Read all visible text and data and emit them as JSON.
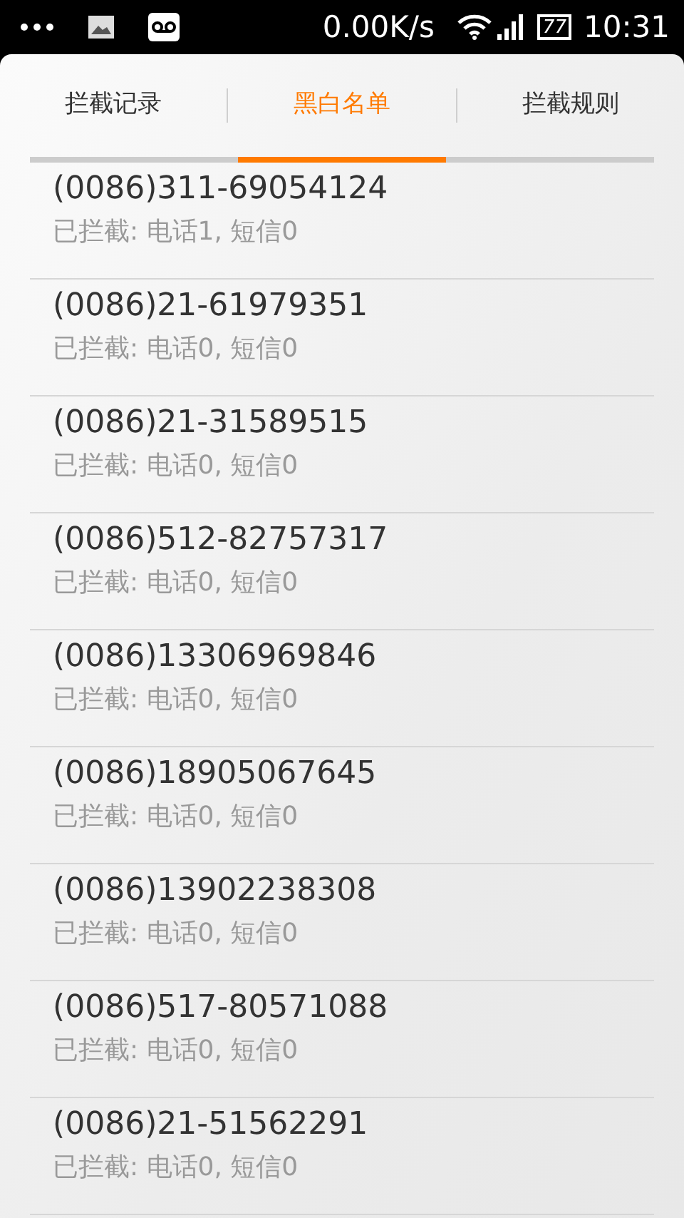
{
  "status_bar": {
    "speed": "0.00K/s",
    "battery": "77",
    "time": "10:31"
  },
  "tabs": [
    {
      "label": "拦截记录",
      "selected": false
    },
    {
      "label": "黑白名单",
      "selected": true
    },
    {
      "label": "拦截规则",
      "selected": false
    }
  ],
  "entries": [
    {
      "number": "(0086)311-69054124",
      "summary": "已拦截: 电话1, 短信0"
    },
    {
      "number": "(0086)21-61979351",
      "summary": "已拦截: 电话0, 短信0"
    },
    {
      "number": "(0086)21-31589515",
      "summary": "已拦截: 电话0, 短信0"
    },
    {
      "number": "(0086)512-82757317",
      "summary": "已拦截: 电话0, 短信0"
    },
    {
      "number": "(0086)13306969846",
      "summary": "已拦截: 电话0, 短信0"
    },
    {
      "number": "(0086)18905067645",
      "summary": "已拦截: 电话0, 短信0"
    },
    {
      "number": "(0086)13902238308",
      "summary": "已拦截: 电话0, 短信0"
    },
    {
      "number": "(0086)517-80571088",
      "summary": "已拦截: 电话0, 短信0"
    },
    {
      "number": "(0086)21-51562291",
      "summary": "已拦截: 电话0, 短信0"
    }
  ]
}
